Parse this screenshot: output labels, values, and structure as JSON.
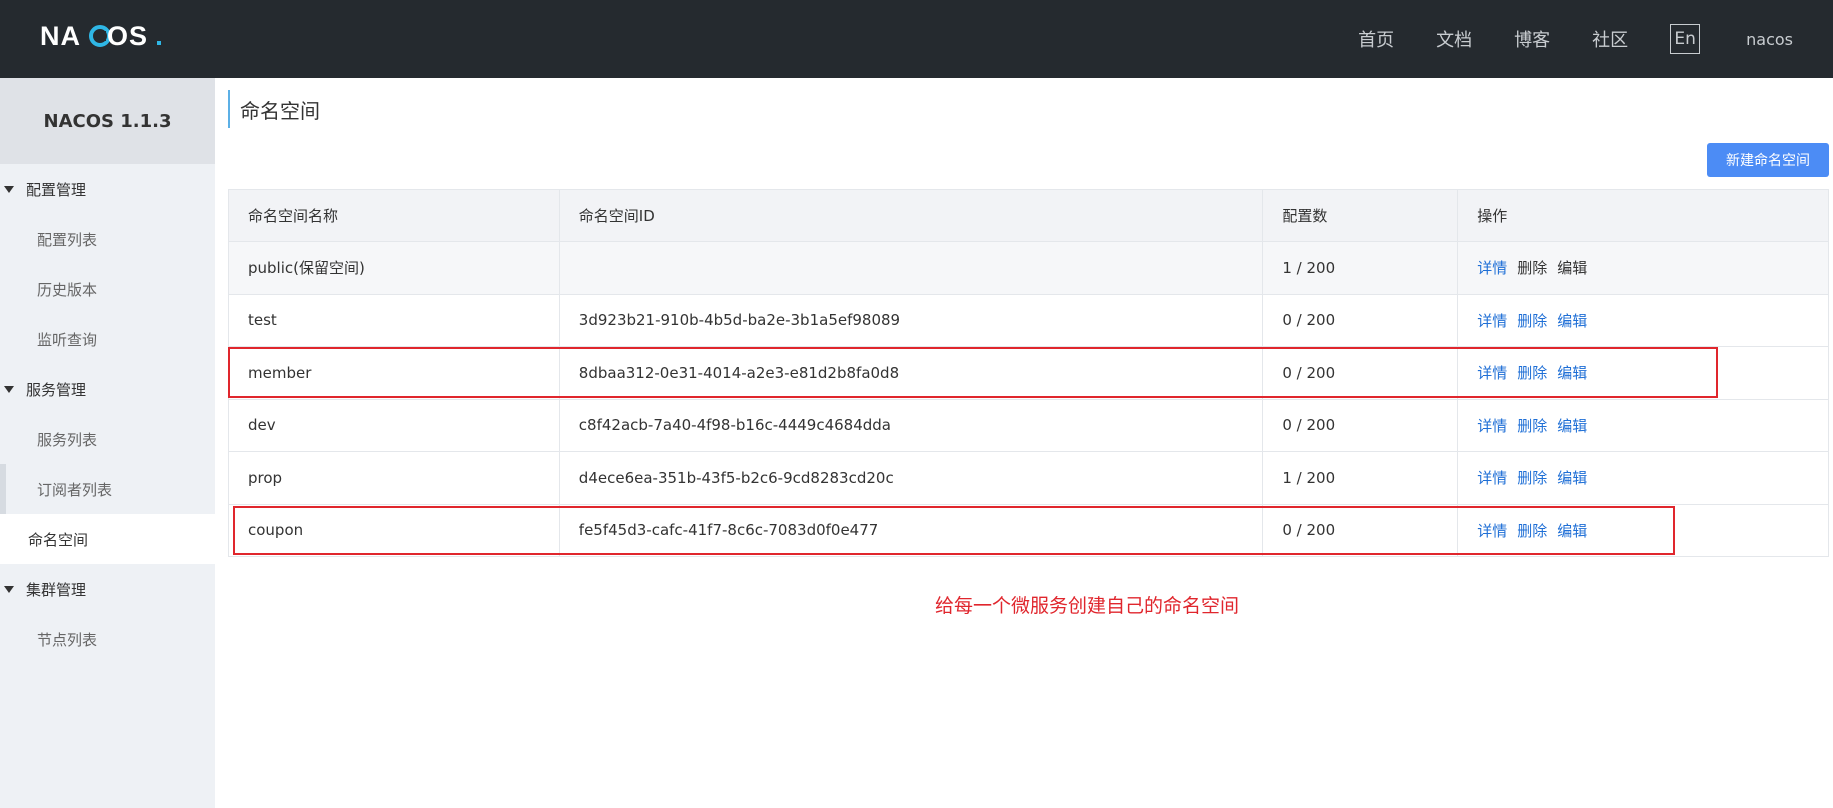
{
  "header": {
    "logo_text": "NACOS.",
    "nav": [
      "首页",
      "文档",
      "博客",
      "社区"
    ],
    "lang_button": "En",
    "user": "nacos"
  },
  "sidebar": {
    "brand": "NACOS 1.1.3",
    "groups": [
      {
        "label": "配置管理",
        "items": [
          "配置列表",
          "历史版本",
          "监听查询"
        ]
      },
      {
        "label": "服务管理",
        "items": [
          "服务列表",
          "订阅者列表",
          "命名空间"
        ]
      },
      {
        "label": "集群管理",
        "items": [
          "节点列表"
        ]
      }
    ]
  },
  "main": {
    "title": "命名空间",
    "new_button": "新建命名空间",
    "table": {
      "headers": [
        "命名空间名称",
        "命名空间ID",
        "配置数",
        "操作"
      ],
      "rows": [
        {
          "name": "public(保留空间)",
          "id": "",
          "count": "1 / 200"
        },
        {
          "name": "test",
          "id": "3d923b21-910b-4b5d-ba2e-3b1a5ef98089",
          "count": "0 / 200"
        },
        {
          "name": "member",
          "id": "8dbaa312-0e31-4014-a2e3-e81d2b8fa0d8",
          "count": "0 / 200"
        },
        {
          "name": "dev",
          "id": "c8f42acb-7a40-4f98-b16c-4449c4684dda",
          "count": "0 / 200"
        },
        {
          "name": "prop",
          "id": "d4ece6ea-351b-43f5-b2c6-9cd8283cd20c",
          "count": "1 / 200"
        },
        {
          "name": "coupon",
          "id": "fe5f45d3-cafc-41f7-8c6c-7083d0f0e477",
          "count": "0 / 200"
        }
      ],
      "actions": {
        "detail": "详情",
        "delete": "删除",
        "edit": "编辑"
      }
    },
    "annotation": "给每一个微服务创建自己的命名空间",
    "accent_color": "#4c8cf5",
    "highlight_color": "#e0262d"
  }
}
